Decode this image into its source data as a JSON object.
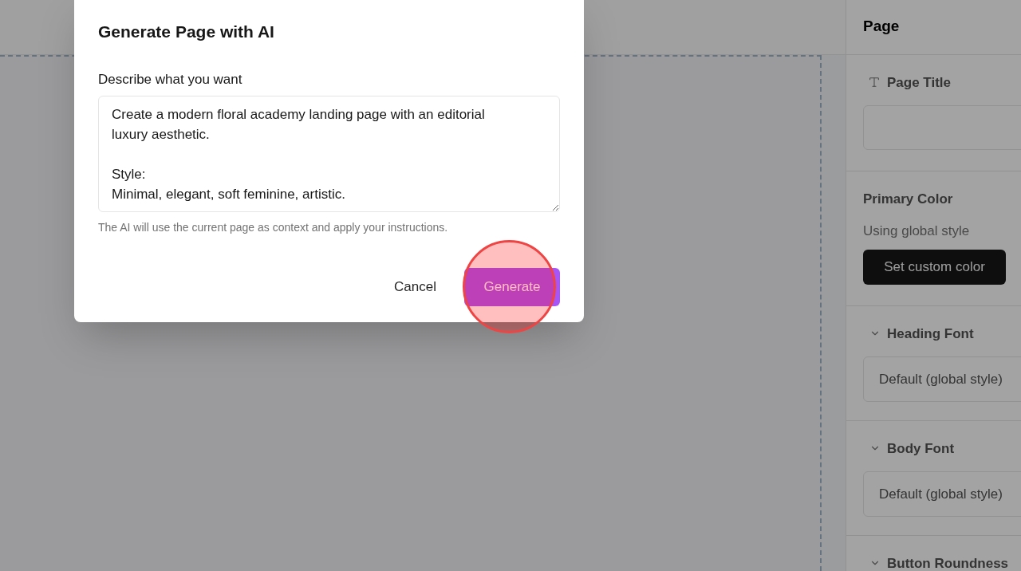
{
  "dialog": {
    "title": "Generate Page with AI",
    "prompt": {
      "label": "Describe what you want",
      "value": "Create a modern floral academy landing page with an editorial luxury aesthetic.\n\nStyle:\nMinimal, elegant, soft feminine, artistic."
    },
    "hint": "The AI will use the current page as context and apply your instructions.",
    "buttons": [
      {
        "label": "Cancel",
        "kind": "ghost",
        "highlighted": false
      },
      {
        "label": "Generate",
        "kind": "primary",
        "highlighted": true
      }
    ]
  },
  "sidebar": {
    "title": "Page",
    "sections": [
      {
        "kind": "text_input",
        "label": "Page Title"
      },
      {
        "kind": "color",
        "label": "Primary Color",
        "status": "Using global style",
        "button": "Set custom color"
      },
      {
        "kind": "select",
        "label": "Heading Font",
        "value": "Default (global style)"
      },
      {
        "kind": "select",
        "label": "Body Font",
        "value": "Default (global style)"
      },
      {
        "kind": "select",
        "label": "Button Roundness"
      }
    ]
  }
}
